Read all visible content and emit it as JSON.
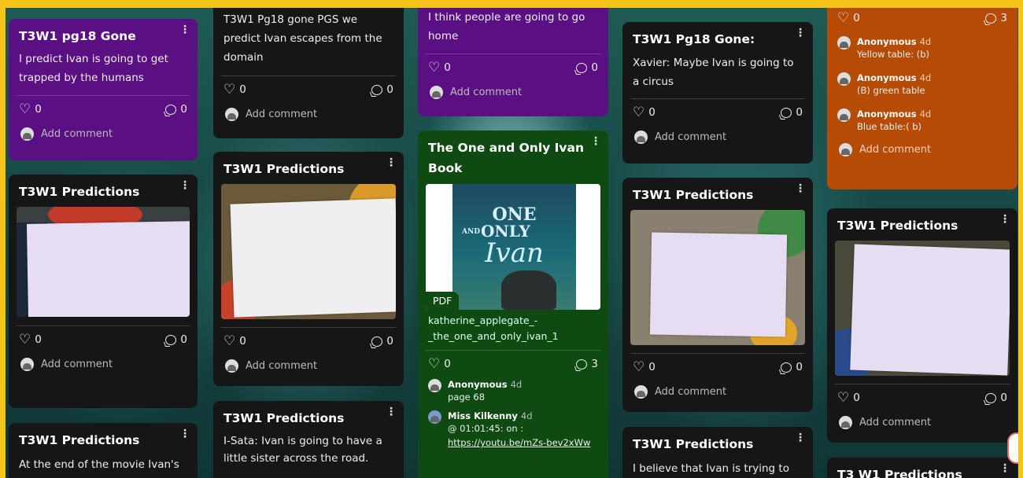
{
  "colors": {
    "frame": "#f5c41a",
    "purple": "#5a0f82",
    "dark": "#161616",
    "green": "#0e4a12",
    "orange": "#b64b05"
  },
  "icons": {
    "like": "heart-icon",
    "comment": "comment-bubble-icon",
    "more": "kebab-menu-icon",
    "avatar": "avatar-icon"
  },
  "columns": [
    {
      "cards": [
        {
          "title": "T3W1 pg18 Gone",
          "body": "I predict Ivan is going to get trapped by the humans",
          "likes": "0",
          "comments": "0",
          "add": "Add comment"
        },
        {
          "title": "T3W1 Predictions",
          "likes": "0",
          "comments": "0",
          "add": "Add comment"
        },
        {
          "title": "T3W1 Predictions",
          "body": "At the end of the movie Ivan's"
        }
      ]
    },
    {
      "cards": [
        {
          "body": "T3W1 Pg18 gone PGS we predict Ivan escapes from the domain",
          "likes": "0",
          "comments": "0",
          "add": "Add comment"
        },
        {
          "title": "T3W1 Predictions",
          "likes": "0",
          "comments": "0",
          "add": "Add comment"
        },
        {
          "title": "T3W1 Predictions",
          "body": "I-Sata: Ivan is going to have a little sister across the road."
        }
      ]
    },
    {
      "cards": [
        {
          "body": "I think people are going to go home",
          "likes": "0",
          "comments": "0",
          "add": "Add comment"
        },
        {
          "title": "The One and Only Ivan Book",
          "cover_text_1": "ONE",
          "cover_text_2": "AND",
          "cover_text_3": "ONLY",
          "cover_text_4": "Ivan",
          "badge": "PDF",
          "filename": "katherine_applegate_-_the_one_and_only_ivan_1",
          "likes": "0",
          "comments": "3",
          "comment_list": [
            {
              "author": "Anonymous",
              "ago": "4d",
              "text": "page 68"
            },
            {
              "author": "Miss Kilkenny",
              "ago": "4d",
              "text": "@ 01:01:45: on :",
              "link": "https://youtu.be/mZs-bev2xWw"
            }
          ]
        }
      ]
    },
    {
      "cards": [
        {
          "title": "T3W1 Pg18 Gone:",
          "body": "Xavier: Maybe Ivan is going to a circus",
          "likes": "0",
          "comments": "0",
          "add": "Add comment"
        },
        {
          "title": "T3W1 Predictions",
          "likes": "0",
          "comments": "0",
          "add": "Add comment"
        },
        {
          "title": "T3W1 Predictions",
          "body": "I believe that Ivan is trying to"
        }
      ]
    },
    {
      "cards": [
        {
          "likes": "0",
          "comments": "3",
          "add": "Add comment",
          "comment_list": [
            {
              "author": "Anonymous",
              "ago": "4d",
              "text": "Yellow table: (b)"
            },
            {
              "author": "Anonymous",
              "ago": "4d",
              "text": "(B) green table"
            },
            {
              "author": "Anonymous",
              "ago": "4d",
              "text": "Blue table:( b)"
            }
          ]
        },
        {
          "title": "T3W1 Predictions",
          "likes": "0",
          "comments": "0",
          "add": "Add comment"
        },
        {
          "title": "T3 W1 Predictions"
        }
      ]
    }
  ]
}
